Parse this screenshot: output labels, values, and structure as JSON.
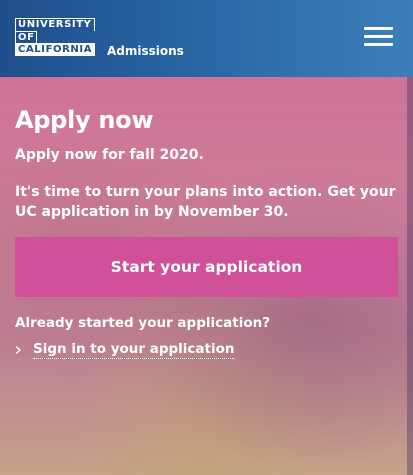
{
  "header": {
    "logo": {
      "line1": "UNIVERSITY",
      "line2": "OF",
      "line3": "CALIFORNIA"
    },
    "section": "Admissions"
  },
  "hero": {
    "title": "Apply now",
    "subtitle": "Apply now for fall 2020.",
    "body": "It's time to turn your plans into action. Get your UC application in by November 30.",
    "cta_label": "Start your application",
    "already_started": "Already started your application?",
    "signin_link": "Sign in to your application"
  },
  "colors": {
    "header": "#1f4e8c",
    "cta": "#d0519a",
    "text": "#ffffff"
  }
}
